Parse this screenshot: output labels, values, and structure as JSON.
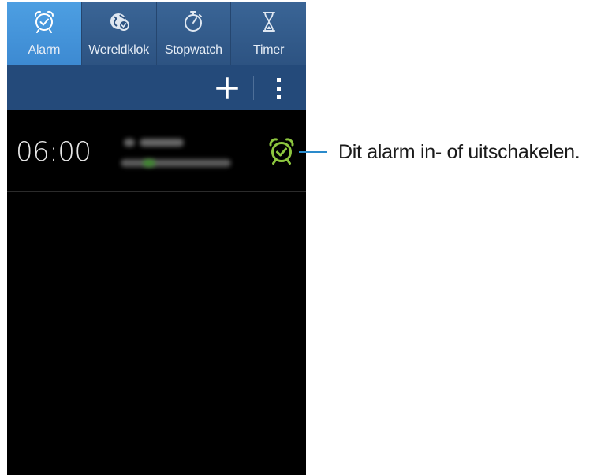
{
  "tabs": [
    {
      "label": "Alarm",
      "icon": "alarm-clock-icon",
      "active": true
    },
    {
      "label": "Wereldklok",
      "icon": "world-clock-icon",
      "active": false
    },
    {
      "label": "Stopwatch",
      "icon": "stopwatch-icon",
      "active": false
    },
    {
      "label": "Timer",
      "icon": "hourglass-icon",
      "active": false
    }
  ],
  "actionbar": {
    "add_icon": "plus-icon",
    "more_icon": "more-vertical-icon"
  },
  "alarm": {
    "time": "06:00",
    "toggle_icon": "alarm-clock-icon",
    "toggle_color": "#8dc63f",
    "enabled": true
  },
  "callout": {
    "text": "Dit alarm in- of uitschakelen."
  },
  "colors": {
    "tab_active": "#4d9fe2",
    "tab_bar": "#2d5382",
    "action_bar": "#244a7a",
    "background": "#000000",
    "callout_line": "#2a8acb"
  }
}
